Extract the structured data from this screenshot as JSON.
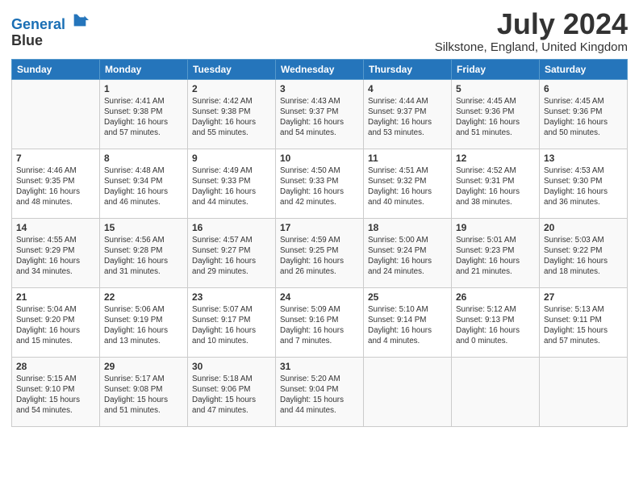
{
  "logo": {
    "line1": "General",
    "line2": "Blue"
  },
  "title": "July 2024",
  "location": "Silkstone, England, United Kingdom",
  "weekdays": [
    "Sunday",
    "Monday",
    "Tuesday",
    "Wednesday",
    "Thursday",
    "Friday",
    "Saturday"
  ],
  "weeks": [
    [
      {
        "day": "",
        "info": ""
      },
      {
        "day": "1",
        "info": "Sunrise: 4:41 AM\nSunset: 9:38 PM\nDaylight: 16 hours\nand 57 minutes."
      },
      {
        "day": "2",
        "info": "Sunrise: 4:42 AM\nSunset: 9:38 PM\nDaylight: 16 hours\nand 55 minutes."
      },
      {
        "day": "3",
        "info": "Sunrise: 4:43 AM\nSunset: 9:37 PM\nDaylight: 16 hours\nand 54 minutes."
      },
      {
        "day": "4",
        "info": "Sunrise: 4:44 AM\nSunset: 9:37 PM\nDaylight: 16 hours\nand 53 minutes."
      },
      {
        "day": "5",
        "info": "Sunrise: 4:45 AM\nSunset: 9:36 PM\nDaylight: 16 hours\nand 51 minutes."
      },
      {
        "day": "6",
        "info": "Sunrise: 4:45 AM\nSunset: 9:36 PM\nDaylight: 16 hours\nand 50 minutes."
      }
    ],
    [
      {
        "day": "7",
        "info": "Sunrise: 4:46 AM\nSunset: 9:35 PM\nDaylight: 16 hours\nand 48 minutes."
      },
      {
        "day": "8",
        "info": "Sunrise: 4:48 AM\nSunset: 9:34 PM\nDaylight: 16 hours\nand 46 minutes."
      },
      {
        "day": "9",
        "info": "Sunrise: 4:49 AM\nSunset: 9:33 PM\nDaylight: 16 hours\nand 44 minutes."
      },
      {
        "day": "10",
        "info": "Sunrise: 4:50 AM\nSunset: 9:33 PM\nDaylight: 16 hours\nand 42 minutes."
      },
      {
        "day": "11",
        "info": "Sunrise: 4:51 AM\nSunset: 9:32 PM\nDaylight: 16 hours\nand 40 minutes."
      },
      {
        "day": "12",
        "info": "Sunrise: 4:52 AM\nSunset: 9:31 PM\nDaylight: 16 hours\nand 38 minutes."
      },
      {
        "day": "13",
        "info": "Sunrise: 4:53 AM\nSunset: 9:30 PM\nDaylight: 16 hours\nand 36 minutes."
      }
    ],
    [
      {
        "day": "14",
        "info": "Sunrise: 4:55 AM\nSunset: 9:29 PM\nDaylight: 16 hours\nand 34 minutes."
      },
      {
        "day": "15",
        "info": "Sunrise: 4:56 AM\nSunset: 9:28 PM\nDaylight: 16 hours\nand 31 minutes."
      },
      {
        "day": "16",
        "info": "Sunrise: 4:57 AM\nSunset: 9:27 PM\nDaylight: 16 hours\nand 29 minutes."
      },
      {
        "day": "17",
        "info": "Sunrise: 4:59 AM\nSunset: 9:25 PM\nDaylight: 16 hours\nand 26 minutes."
      },
      {
        "day": "18",
        "info": "Sunrise: 5:00 AM\nSunset: 9:24 PM\nDaylight: 16 hours\nand 24 minutes."
      },
      {
        "day": "19",
        "info": "Sunrise: 5:01 AM\nSunset: 9:23 PM\nDaylight: 16 hours\nand 21 minutes."
      },
      {
        "day": "20",
        "info": "Sunrise: 5:03 AM\nSunset: 9:22 PM\nDaylight: 16 hours\nand 18 minutes."
      }
    ],
    [
      {
        "day": "21",
        "info": "Sunrise: 5:04 AM\nSunset: 9:20 PM\nDaylight: 16 hours\nand 15 minutes."
      },
      {
        "day": "22",
        "info": "Sunrise: 5:06 AM\nSunset: 9:19 PM\nDaylight: 16 hours\nand 13 minutes."
      },
      {
        "day": "23",
        "info": "Sunrise: 5:07 AM\nSunset: 9:17 PM\nDaylight: 16 hours\nand 10 minutes."
      },
      {
        "day": "24",
        "info": "Sunrise: 5:09 AM\nSunset: 9:16 PM\nDaylight: 16 hours\nand 7 minutes."
      },
      {
        "day": "25",
        "info": "Sunrise: 5:10 AM\nSunset: 9:14 PM\nDaylight: 16 hours\nand 4 minutes."
      },
      {
        "day": "26",
        "info": "Sunrise: 5:12 AM\nSunset: 9:13 PM\nDaylight: 16 hours\nand 0 minutes."
      },
      {
        "day": "27",
        "info": "Sunrise: 5:13 AM\nSunset: 9:11 PM\nDaylight: 15 hours\nand 57 minutes."
      }
    ],
    [
      {
        "day": "28",
        "info": "Sunrise: 5:15 AM\nSunset: 9:10 PM\nDaylight: 15 hours\nand 54 minutes."
      },
      {
        "day": "29",
        "info": "Sunrise: 5:17 AM\nSunset: 9:08 PM\nDaylight: 15 hours\nand 51 minutes."
      },
      {
        "day": "30",
        "info": "Sunrise: 5:18 AM\nSunset: 9:06 PM\nDaylight: 15 hours\nand 47 minutes."
      },
      {
        "day": "31",
        "info": "Sunrise: 5:20 AM\nSunset: 9:04 PM\nDaylight: 15 hours\nand 44 minutes."
      },
      {
        "day": "",
        "info": ""
      },
      {
        "day": "",
        "info": ""
      },
      {
        "day": "",
        "info": ""
      }
    ]
  ]
}
